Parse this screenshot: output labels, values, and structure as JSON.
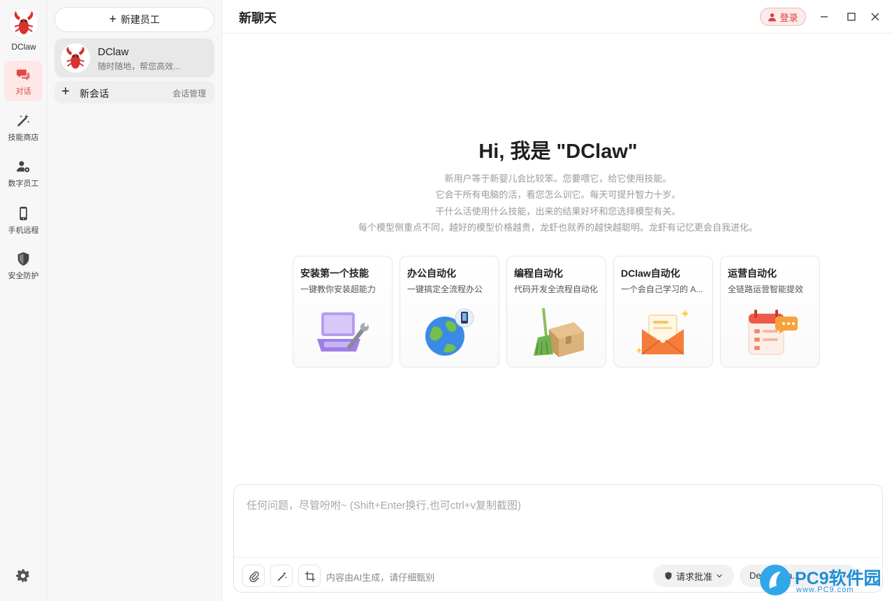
{
  "rail": {
    "brand": "DClaw",
    "items": [
      {
        "label": "对话",
        "icon": "chat-icon"
      },
      {
        "label": "技能商店",
        "icon": "magic-wand-icon"
      },
      {
        "label": "数字员工",
        "icon": "user-gear-icon"
      },
      {
        "label": "手机远程",
        "icon": "phone-icon"
      },
      {
        "label": "安全防护",
        "icon": "shield-icon"
      }
    ],
    "settings_icon": "gear-icon",
    "accent": "#e04848"
  },
  "employees": {
    "new_button": "新建员工",
    "list": [
      {
        "name": "DClaw",
        "desc": "随时随地，帮您高效..."
      }
    ],
    "new_chat": "新会话",
    "manage": "会话管理"
  },
  "header": {
    "title": "新聊天",
    "login": "登录"
  },
  "welcome": {
    "heading": "Hi, 我是 \"DClaw\"",
    "lines": [
      "新用户等于新婴儿会比较笨。您要喂它，给它使用技能。",
      "它会干所有电脑的活，看您怎么训它。每天可提升智力十岁。",
      "干什么活使用什么技能，出来的结果好坏和您选择模型有关。",
      "每个模型侧重点不同，越好的模型价格越贵，龙虾也就养的越快越聪明。龙虾有记忆更会自我进化。"
    ]
  },
  "cards": [
    {
      "title": "安装第一个技能",
      "desc": "一键教你安装超能力",
      "icon": "laptop-wrench-icon"
    },
    {
      "title": "办公自动化",
      "desc": "一键搞定全流程办公",
      "icon": "globe-phone-icon"
    },
    {
      "title": "编程自动化",
      "desc": "代码开发全流程自动化",
      "icon": "broom-box-icon"
    },
    {
      "title": "DClaw自动化",
      "desc": "一个会自己学习的 A...",
      "icon": "envelope-icon"
    },
    {
      "title": "运营自动化",
      "desc": "全链路运营智能提效",
      "icon": "calendar-chat-icon"
    }
  ],
  "composer": {
    "placeholder": "任何问题，尽管吩咐~ (Shift+Enter换行,也可ctrl+v复制截图)",
    "disclaimer": "内容由AI生成，请仔细甄别",
    "approve": "请求批准",
    "model": "De...   V Fla..."
  },
  "watermark": {
    "text": "PC9软件园",
    "sub": "www.PC9.com"
  }
}
